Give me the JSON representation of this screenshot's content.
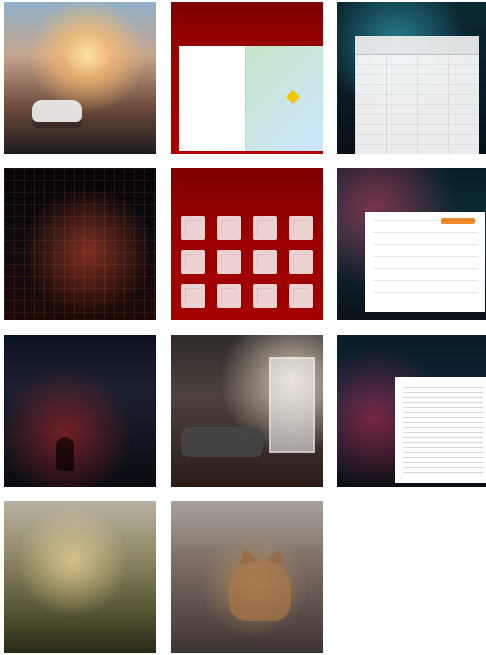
{
  "gallery": {
    "tiles": [
      {
        "name": "image-tile-street"
      },
      {
        "name": "image-tile-map-document"
      },
      {
        "name": "image-tile-cyber-table"
      },
      {
        "name": "image-tile-city-grid"
      },
      {
        "name": "image-tile-floorplans"
      },
      {
        "name": "image-tile-cyber-form"
      },
      {
        "name": "image-tile-night-map"
      },
      {
        "name": "image-tile-living-room"
      },
      {
        "name": "image-tile-cyber-document"
      },
      {
        "name": "image-tile-painting-city"
      },
      {
        "name": "image-tile-cat"
      }
    ]
  }
}
